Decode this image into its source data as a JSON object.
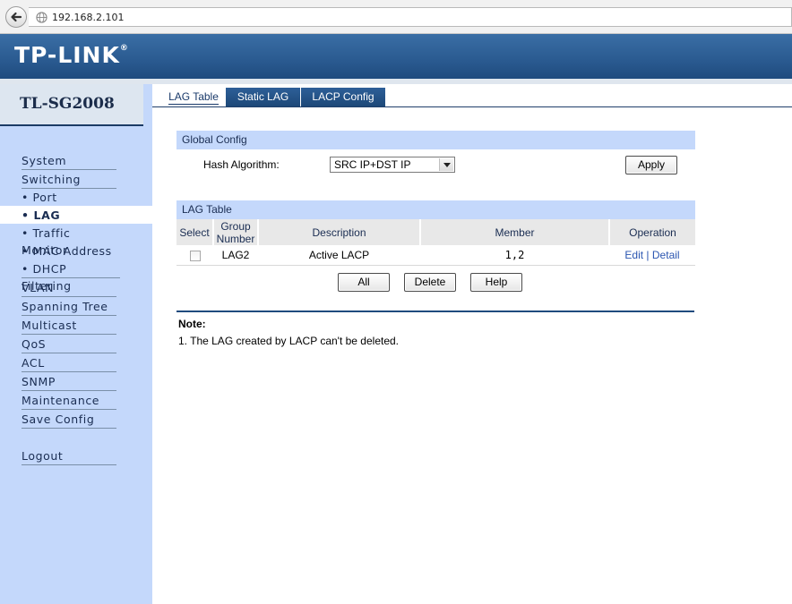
{
  "browser": {
    "url": "192.168.2.101",
    "back_icon": "back-arrow-icon",
    "site_icon": "globe-icon"
  },
  "header": {
    "logo": "TP-LINK",
    "logo_mark": "®",
    "brand_color": "#2a5a90"
  },
  "sidebar": {
    "model": "TL-SG2008",
    "items": [
      {
        "label": "System"
      },
      {
        "label": "Switching"
      },
      {
        "label": "• Port"
      },
      {
        "label": "• LAG"
      },
      {
        "label": "• Traffic Monitor"
      },
      {
        "label": "• MAC Address"
      },
      {
        "label": "• DHCP Filtering"
      },
      {
        "label": "VLAN"
      },
      {
        "label": "Spanning Tree"
      },
      {
        "label": "Multicast"
      },
      {
        "label": "QoS"
      },
      {
        "label": "ACL"
      },
      {
        "label": "SNMP"
      },
      {
        "label": "Maintenance"
      },
      {
        "label": "Save Config"
      },
      {
        "label": "Logout"
      }
    ],
    "active_item": "• LAG",
    "bg_color": "#c4d8fb"
  },
  "tabs": [
    {
      "label": "LAG Table",
      "active": true
    },
    {
      "label": "Static LAG",
      "active": false
    },
    {
      "label": "LACP Config",
      "active": false
    }
  ],
  "global_config": {
    "title": "Global Config",
    "hash_label": "Hash Algorithm:",
    "hash_value": "SRC IP+DST IP",
    "apply_label": "Apply"
  },
  "lag_table": {
    "title": "LAG Table",
    "headers": {
      "select": "Select",
      "group_number": "Group Number",
      "description": "Description",
      "member": "Member",
      "operation": "Operation"
    },
    "rows": [
      {
        "checked": false,
        "group": "LAG2",
        "description": "Active LACP",
        "member": "1,2",
        "edit": "Edit",
        "separator": " | ",
        "detail": "Detail"
      }
    ],
    "buttons": {
      "all": "All",
      "delete": "Delete",
      "help": "Help"
    }
  },
  "note": {
    "title": "Note:",
    "text": "1. The LAG created by LACP can't be deleted."
  }
}
